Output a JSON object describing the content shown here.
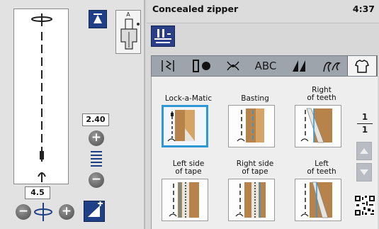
{
  "header": {
    "title": "Concealed zipper",
    "clock": "4:37"
  },
  "left": {
    "presser_foot_letter": "A",
    "width_value": "2.40",
    "length_value": "4.5"
  },
  "tabs": [
    {
      "icon": "utility-stitches-icon"
    },
    {
      "icon": "buttonhole-icon"
    },
    {
      "icon": "decorative-stitches-icon"
    },
    {
      "label": "ABC"
    },
    {
      "icon": "quilting-icon"
    },
    {
      "icon": "applique-icon"
    },
    {
      "icon": "garment-icon",
      "active": true
    }
  ],
  "stitches": [
    {
      "label": "Lock-a-Matic",
      "selected": true
    },
    {
      "label": "Basting"
    },
    {
      "label": "Right\nof teeth"
    },
    {
      "label": "Left side\nof tape"
    },
    {
      "label": "Right side\nof tape"
    },
    {
      "label": "Left\nof teeth"
    }
  ],
  "page": {
    "current": "1",
    "total": "1"
  },
  "colors": {
    "accent_blue": "#1f3f86",
    "selection_blue": "#2f97d6"
  }
}
